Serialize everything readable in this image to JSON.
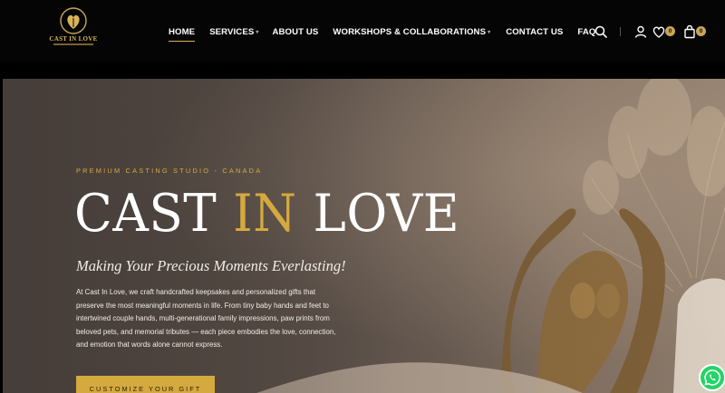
{
  "brand": {
    "name": "CAST IN LOVE"
  },
  "nav": {
    "items": [
      {
        "label": "HOME",
        "active": true
      },
      {
        "label": "SERVICES",
        "dropdown": true
      },
      {
        "label": "ABOUT US"
      },
      {
        "label": "WORKSHOPS & COLLABORATIONS",
        "dropdown": true
      },
      {
        "label": "CONTACT US"
      },
      {
        "label": "FAQ"
      }
    ]
  },
  "header_icons": {
    "search": "search-icon",
    "account": "user-icon",
    "wishlist": "heart-icon",
    "wishlist_count": "0",
    "cart": "bag-icon",
    "cart_count": "0"
  },
  "hero": {
    "eyebrow": "PREMIUM CASTING STUDIO - CANADA",
    "title_part1": "CAST ",
    "title_part2": "IN",
    "title_part3": " LOVE",
    "subtitle": "Making Your Precious Moments Everlasting!",
    "description": "At Cast In Love, we craft handcrafted keepsakes and personalized gifts that preserve the most meaningful moments in life. From tiny baby hands and feet to intertwined couple hands, multi-generational family impressions, paw prints from beloved pets, and memorial tributes — each piece embodies the love, connection, and emotion that words alone cannot express.",
    "cta_label": "CUSTOMIZE YOUR GIFT"
  },
  "floating": {
    "whatsapp": "whatsapp-icon"
  },
  "colors": {
    "accent": "#d4a93e",
    "header_bg": "#050505",
    "badge": "#c9a55a"
  }
}
